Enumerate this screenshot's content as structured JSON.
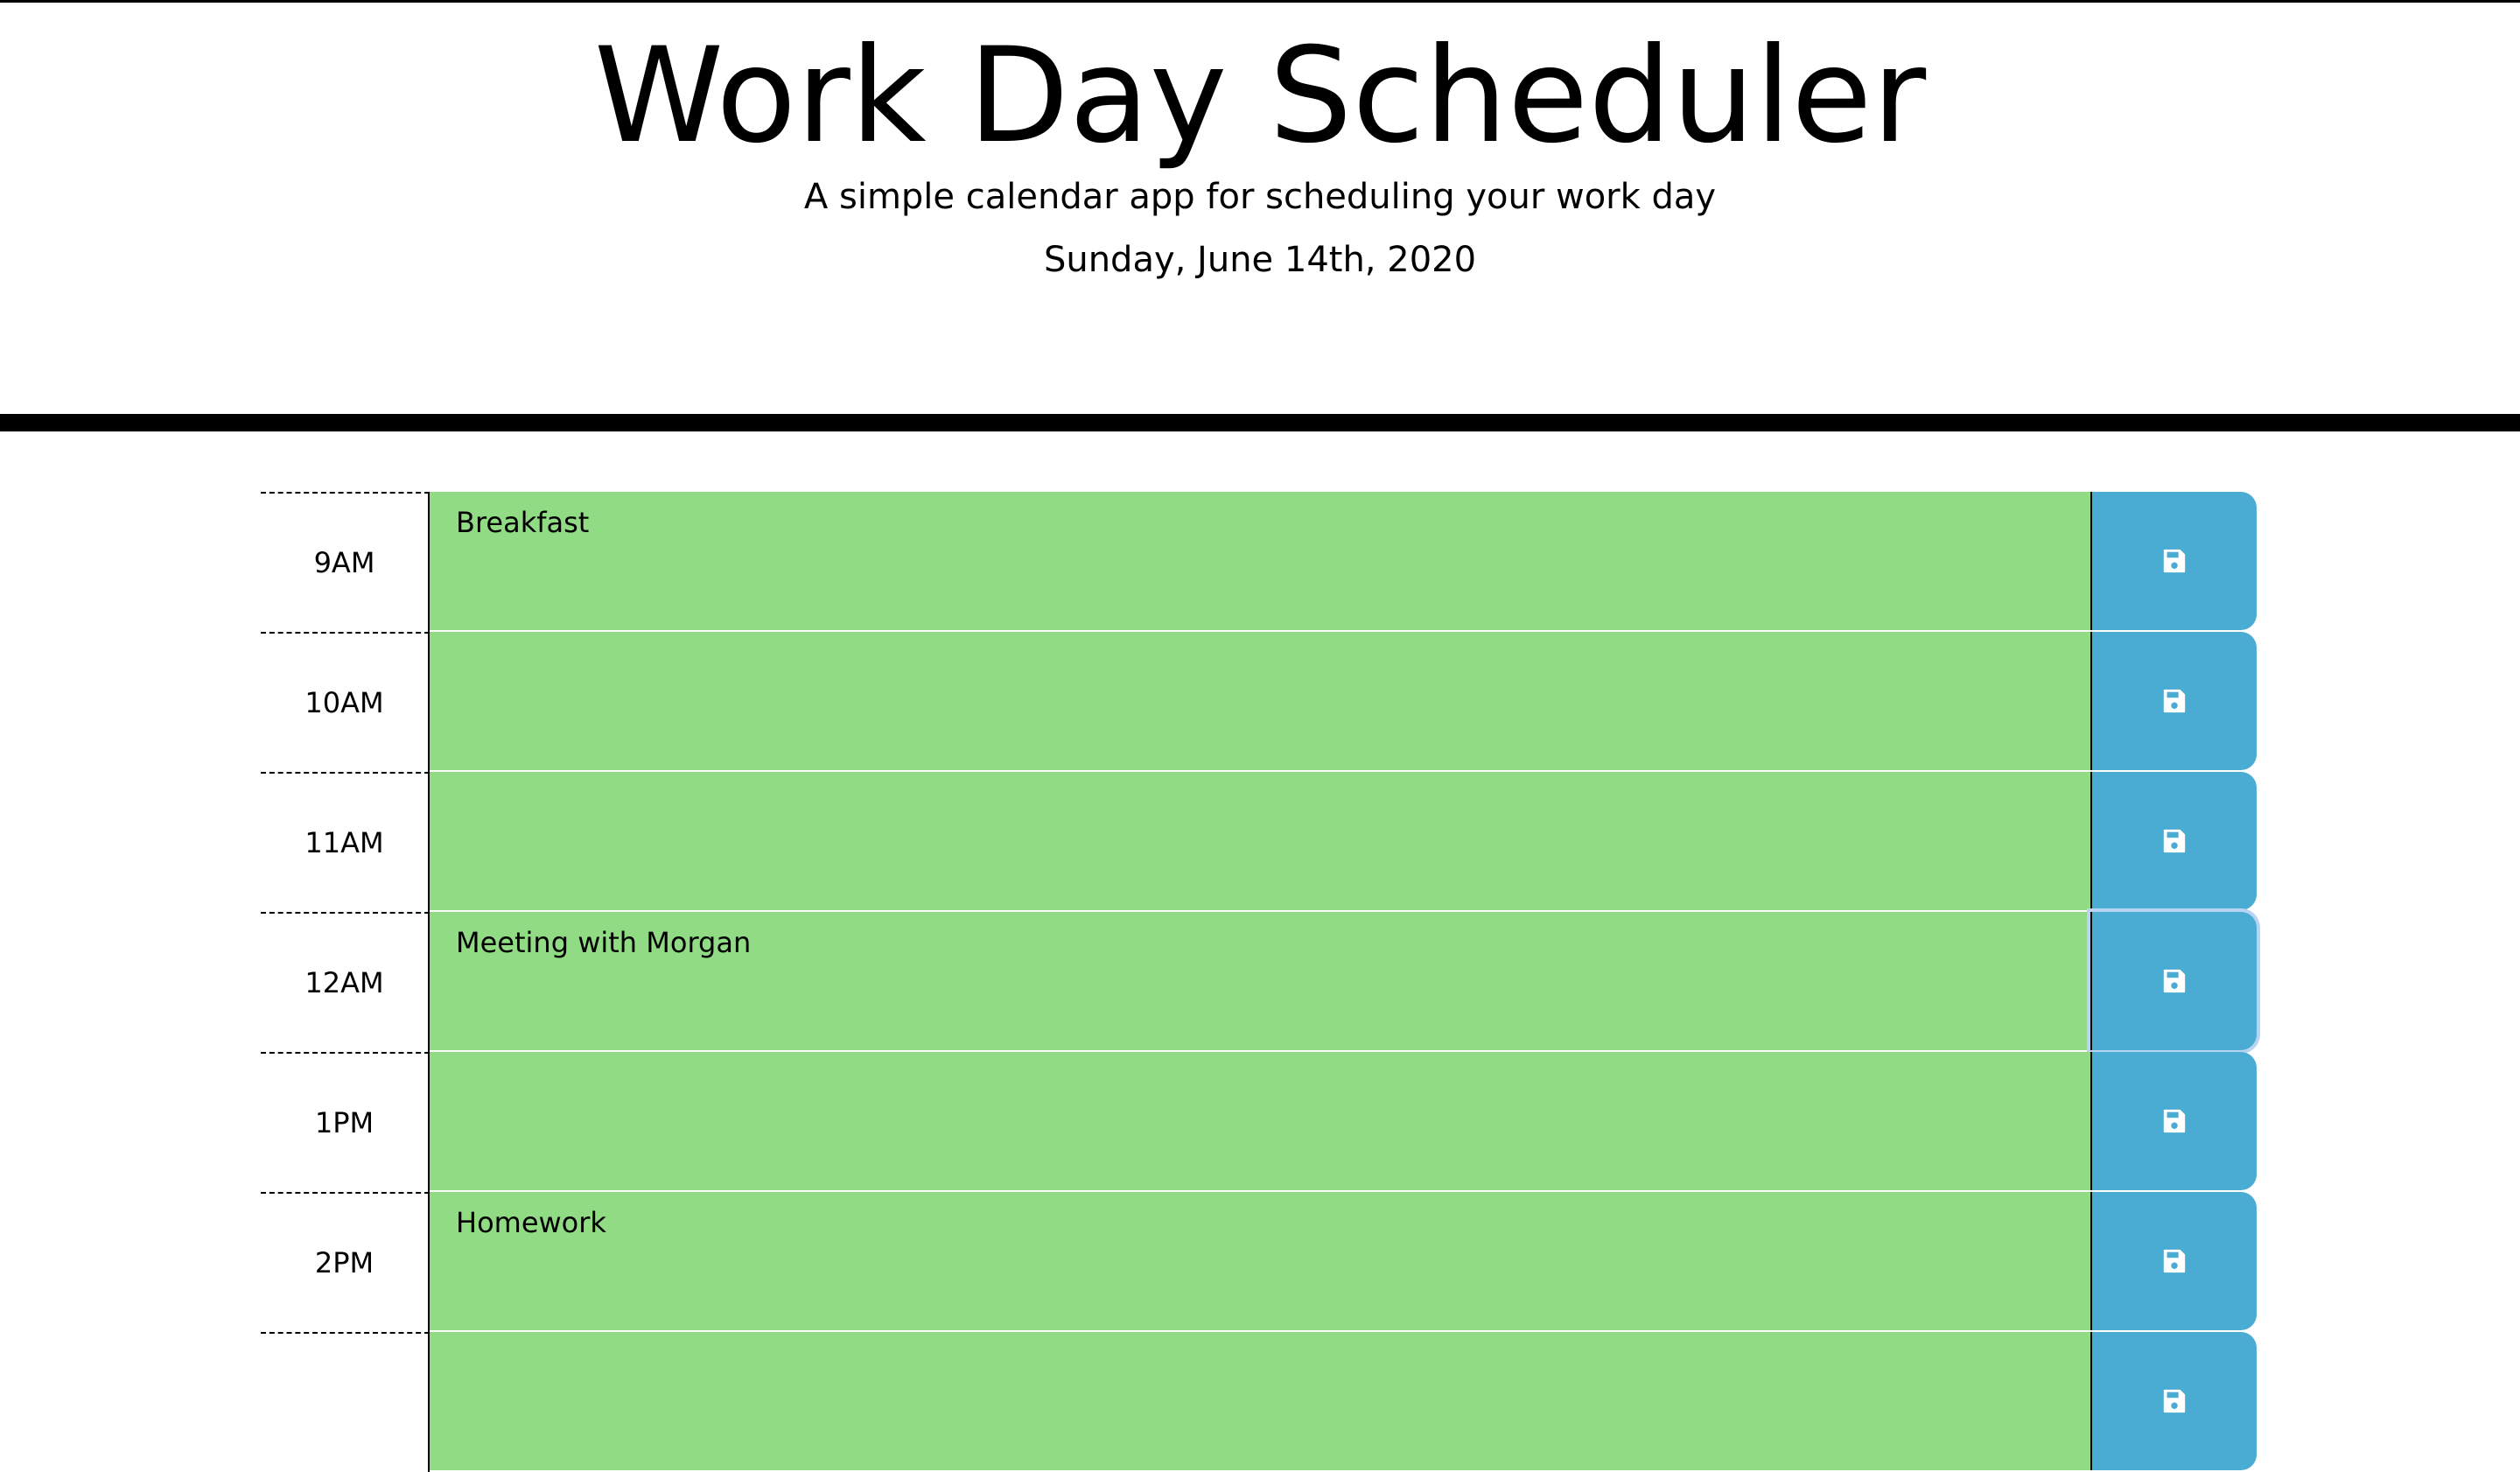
{
  "header": {
    "title": "Work Day Scheduler",
    "subtitle": "A simple calendar app for scheduling your work day",
    "current_day": "Sunday, June 14th, 2020"
  },
  "colors": {
    "present_row": "#90db84",
    "save_button": "#4aabd3",
    "rule": "#000000"
  },
  "time_blocks": [
    {
      "hour": "9AM",
      "text": "Breakfast",
      "save_icon": "floppy-disk-icon"
    },
    {
      "hour": "10AM",
      "text": "",
      "save_icon": "floppy-disk-icon"
    },
    {
      "hour": "11AM",
      "text": "",
      "save_icon": "floppy-disk-icon"
    },
    {
      "hour": "12AM",
      "text": "Meeting with Morgan",
      "save_icon": "floppy-disk-icon"
    },
    {
      "hour": "1PM",
      "text": "",
      "save_icon": "floppy-disk-icon"
    },
    {
      "hour": "2PM",
      "text": "Homework",
      "save_icon": "floppy-disk-icon"
    },
    {
      "hour": "",
      "text": "",
      "save_icon": "floppy-disk-icon"
    }
  ]
}
